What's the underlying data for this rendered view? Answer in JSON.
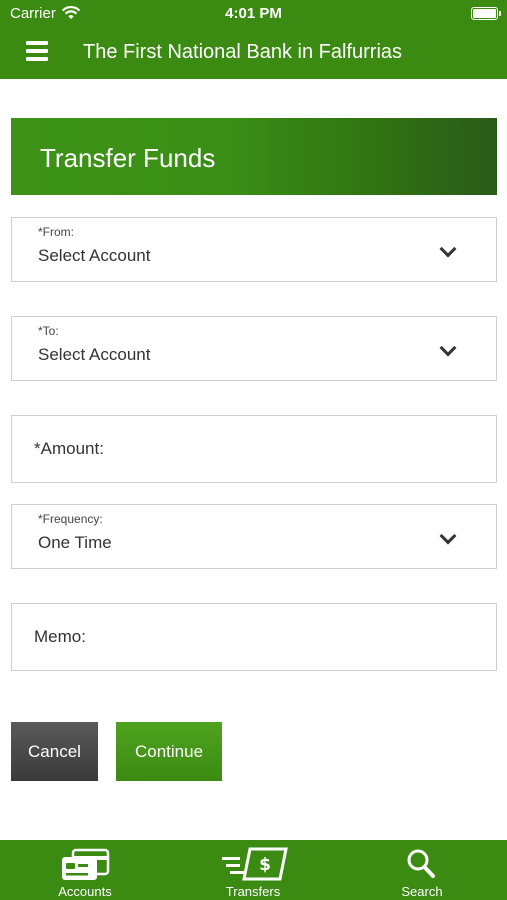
{
  "status_bar": {
    "carrier": "Carrier",
    "time": "4:01 PM"
  },
  "header": {
    "title": "The First National Bank in Falfurrias",
    "menu_icon": "hamburger-menu-icon"
  },
  "page": {
    "title": "Transfer Funds"
  },
  "form": {
    "from": {
      "label": "*From:",
      "value": "Select Account"
    },
    "to": {
      "label": "*To:",
      "value": "Select Account"
    },
    "amount": {
      "placeholder": "*Amount:"
    },
    "frequency": {
      "label": "*Frequency:",
      "value": "One Time"
    },
    "memo": {
      "placeholder": "Memo:"
    }
  },
  "buttons": {
    "cancel": "Cancel",
    "continue": "Continue"
  },
  "tabs": [
    {
      "label": "Accounts",
      "icon": "credit-card-icon"
    },
    {
      "label": "Transfers",
      "icon": "money-transfer-icon"
    },
    {
      "label": "Search",
      "icon": "search-icon"
    }
  ],
  "colors": {
    "brand_green": "#3b8a12",
    "header_gradient_end": "#2b5a1a",
    "cancel_gray": "#4a4a4a"
  }
}
